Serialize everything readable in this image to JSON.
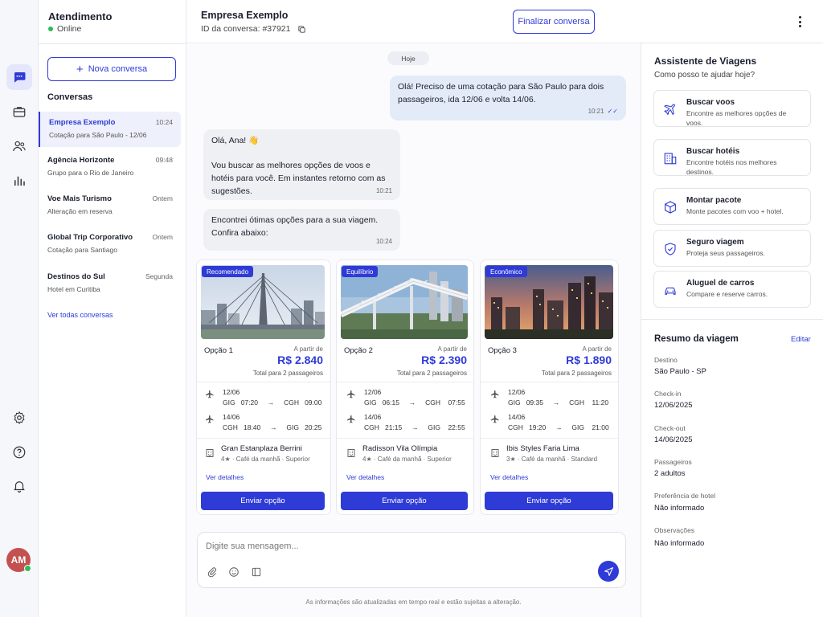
{
  "sidebar": {
    "title": "Atendimento",
    "status": "Online",
    "new_conversation": "Nova conversa",
    "conversations_label": "Conversas",
    "items": [
      {
        "name": "Empresa Exemplo",
        "sub": "Cotação para São Paulo - 12/06",
        "time": "10:24"
      },
      {
        "name": "Agência Horizonte",
        "sub": "Grupo para o Rio de Janeiro",
        "time": "09:48"
      },
      {
        "name": "Voe Mais Turismo",
        "sub": "Alteração em reserva",
        "time": "Ontem"
      },
      {
        "name": "Global Trip Corporativo",
        "sub": "Cotação para Santiago",
        "time": "Ontem"
      },
      {
        "name": "Destinos do Sul",
        "sub": "Hotel em Curitiba",
        "time": "Segunda"
      }
    ],
    "see_all": "Ver todas conversas",
    "avatar_initials": "AM"
  },
  "header": {
    "name": "Empresa Exemplo",
    "conversation_id": "ID da conversa: #37921",
    "finish_button": "Finalizar conversa"
  },
  "chat": {
    "date_pill": "Hoje",
    "messages": [
      {
        "text": "Olá! Preciso de uma cotação para São Paulo para dois passageiros, ida 12/06 e volta 14/06.",
        "time": "10:21"
      },
      {
        "greeting": "Olá, Ana! 👋",
        "text": "Vou buscar as melhores opções de voos e hotéis para você. Em instantes retorno com as sugestões.",
        "time": "10:21"
      },
      {
        "text": "Encontrei ótimas opções para a sua viagem. Confira abaixo:",
        "time": "10:24"
      }
    ],
    "options": [
      {
        "badge": "Recomendado",
        "label": "Opção 1",
        "from": "A partir de",
        "price": "R$ 2.840",
        "total": "Total para 2 passageiros",
        "out": {
          "date": "12/06",
          "from": "GIG",
          "dep": "07:20",
          "to": "CGH",
          "arr": "09:00"
        },
        "back": {
          "date": "14/06",
          "from": "CGH",
          "dep": "18:40",
          "to": "GIG",
          "arr": "20:25"
        },
        "hotel": "Gran Estanplaza Berrini",
        "hotel_sub": "4★ · Café da manhã · Superior",
        "details": "Ver detalhes",
        "send": "Enviar opção"
      },
      {
        "badge": "Equilíbrio",
        "label": "Opção 2",
        "from": "A partir de",
        "price": "R$ 2.390",
        "total": "Total para 2 passageiros",
        "out": {
          "date": "12/06",
          "from": "GIG",
          "dep": "06:15",
          "to": "CGH",
          "arr": "07:55"
        },
        "back": {
          "date": "14/06",
          "from": "CGH",
          "dep": "21:15",
          "to": "GIG",
          "arr": "22:55"
        },
        "hotel": "Radisson Vila Olímpia",
        "hotel_sub": "4★ · Café da manhã · Superior",
        "details": "Ver detalhes",
        "send": "Enviar opção"
      },
      {
        "badge": "Econômico",
        "label": "Opção 3",
        "from": "A partir de",
        "price": "R$ 1.890",
        "total": "Total para 2 passageiros",
        "out": {
          "date": "12/06",
          "from": "GIG",
          "dep": "09:35",
          "to": "CGH",
          "arr": "11:20"
        },
        "back": {
          "date": "14/06",
          "from": "CGH",
          "dep": "19:20",
          "to": "GIG",
          "arr": "21:00"
        },
        "hotel": "Ibis Styles Faria Lima",
        "hotel_sub": "3★ · Café da manhã · Standard",
        "details": "Ver detalhes",
        "send": "Enviar opção"
      }
    ],
    "input_placeholder": "Digite sua mensagem...",
    "disclaimer": "As informações são atualizadas em tempo real e estão sujeitas a alteração."
  },
  "assistant": {
    "title": "Assistente de Viagens",
    "subtitle": "Como posso te ajudar hoje?",
    "actions": [
      {
        "title": "Buscar voos",
        "desc": "Encontre as melhores opções de voos.",
        "icon": "plane-icon"
      },
      {
        "title": "Buscar hotéis",
        "desc": "Encontre hotéis nos melhores destinos.",
        "icon": "hotel-icon"
      },
      {
        "title": "Montar pacote",
        "desc": "Monte pacotes com voo + hotel.",
        "icon": "package-icon"
      },
      {
        "title": "Seguro viagem",
        "desc": "Proteja seus passageiros.",
        "icon": "shield-icon"
      },
      {
        "title": "Aluguel de carros",
        "desc": "Compare e reserve carros.",
        "icon": "car-icon"
      }
    ]
  },
  "summary": {
    "title": "Resumo da viagem",
    "edit": "Editar",
    "fields": [
      {
        "label": "Destino",
        "value": "São Paulo - SP"
      },
      {
        "label": "Check-in",
        "value": "12/06/2025"
      },
      {
        "label": "Check-out",
        "value": "14/06/2025"
      },
      {
        "label": "Passageiros",
        "value": "2 adultos"
      },
      {
        "label": "Preferência de hotel",
        "value": "Não informado"
      },
      {
        "label": "Observações",
        "value": "Não informado"
      }
    ]
  },
  "colors": {
    "accent": "#2f3bd6",
    "online": "#2dbb57",
    "avatar": "#c45151"
  }
}
